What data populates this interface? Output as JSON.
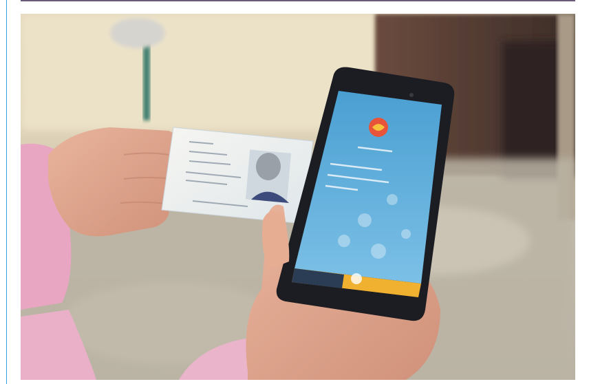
{
  "photo": {
    "subject": "hands-holding-id-card-and-smartphone",
    "card_icon": "photo-id-card-icon",
    "phone_icon": "smartphone-icon",
    "colors": {
      "accent_frame": "#3a9ee0",
      "phone_screen": "#5aa9d6",
      "phone_logo": "#e8543a",
      "phone_bottom_bar": "#f0b030",
      "sleeve_pink": "#e8a3c0",
      "wall": "#e9dcc0",
      "door": "#5a4238",
      "pavement": "#bcb5a6"
    }
  }
}
